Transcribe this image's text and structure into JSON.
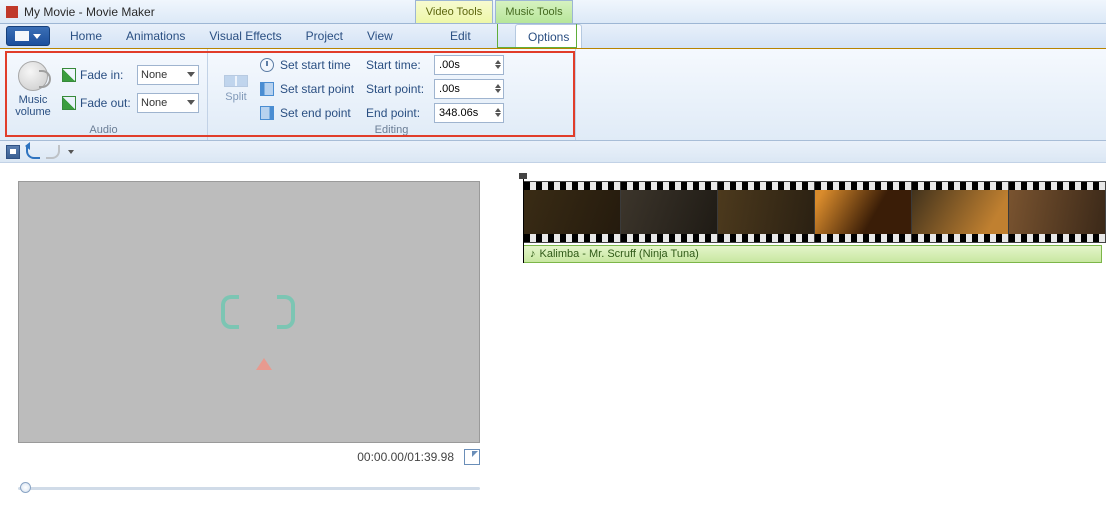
{
  "titlebar": {
    "title": "My Movie - Movie Maker"
  },
  "contextual": {
    "video": "Video Tools",
    "music": "Music Tools"
  },
  "tabs": {
    "home": "Home",
    "animations": "Animations",
    "visual_effects": "Visual Effects",
    "project": "Project",
    "view": "View",
    "edit": "Edit",
    "options": "Options"
  },
  "ribbon": {
    "audio": {
      "group_title": "Audio",
      "music_volume": "Music\nvolume",
      "fade_in_label": "Fade in:",
      "fade_in_value": "None",
      "fade_out_label": "Fade out:",
      "fade_out_value": "None"
    },
    "editing": {
      "group_title": "Editing",
      "split": "Split",
      "set_start_time": "Set start time",
      "set_start_point": "Set start point",
      "set_end_point": "Set end point",
      "start_time_label": "Start time:",
      "start_time_value": ".00s",
      "start_point_label": "Start point:",
      "start_point_value": ".00s",
      "end_point_label": "End point:",
      "end_point_value": "348.06s"
    }
  },
  "preview": {
    "time_display": "00:00.00/01:39.98"
  },
  "timeline": {
    "audio_track_label": "Kalimba - Mr. Scruff (Ninja Tuna)"
  }
}
